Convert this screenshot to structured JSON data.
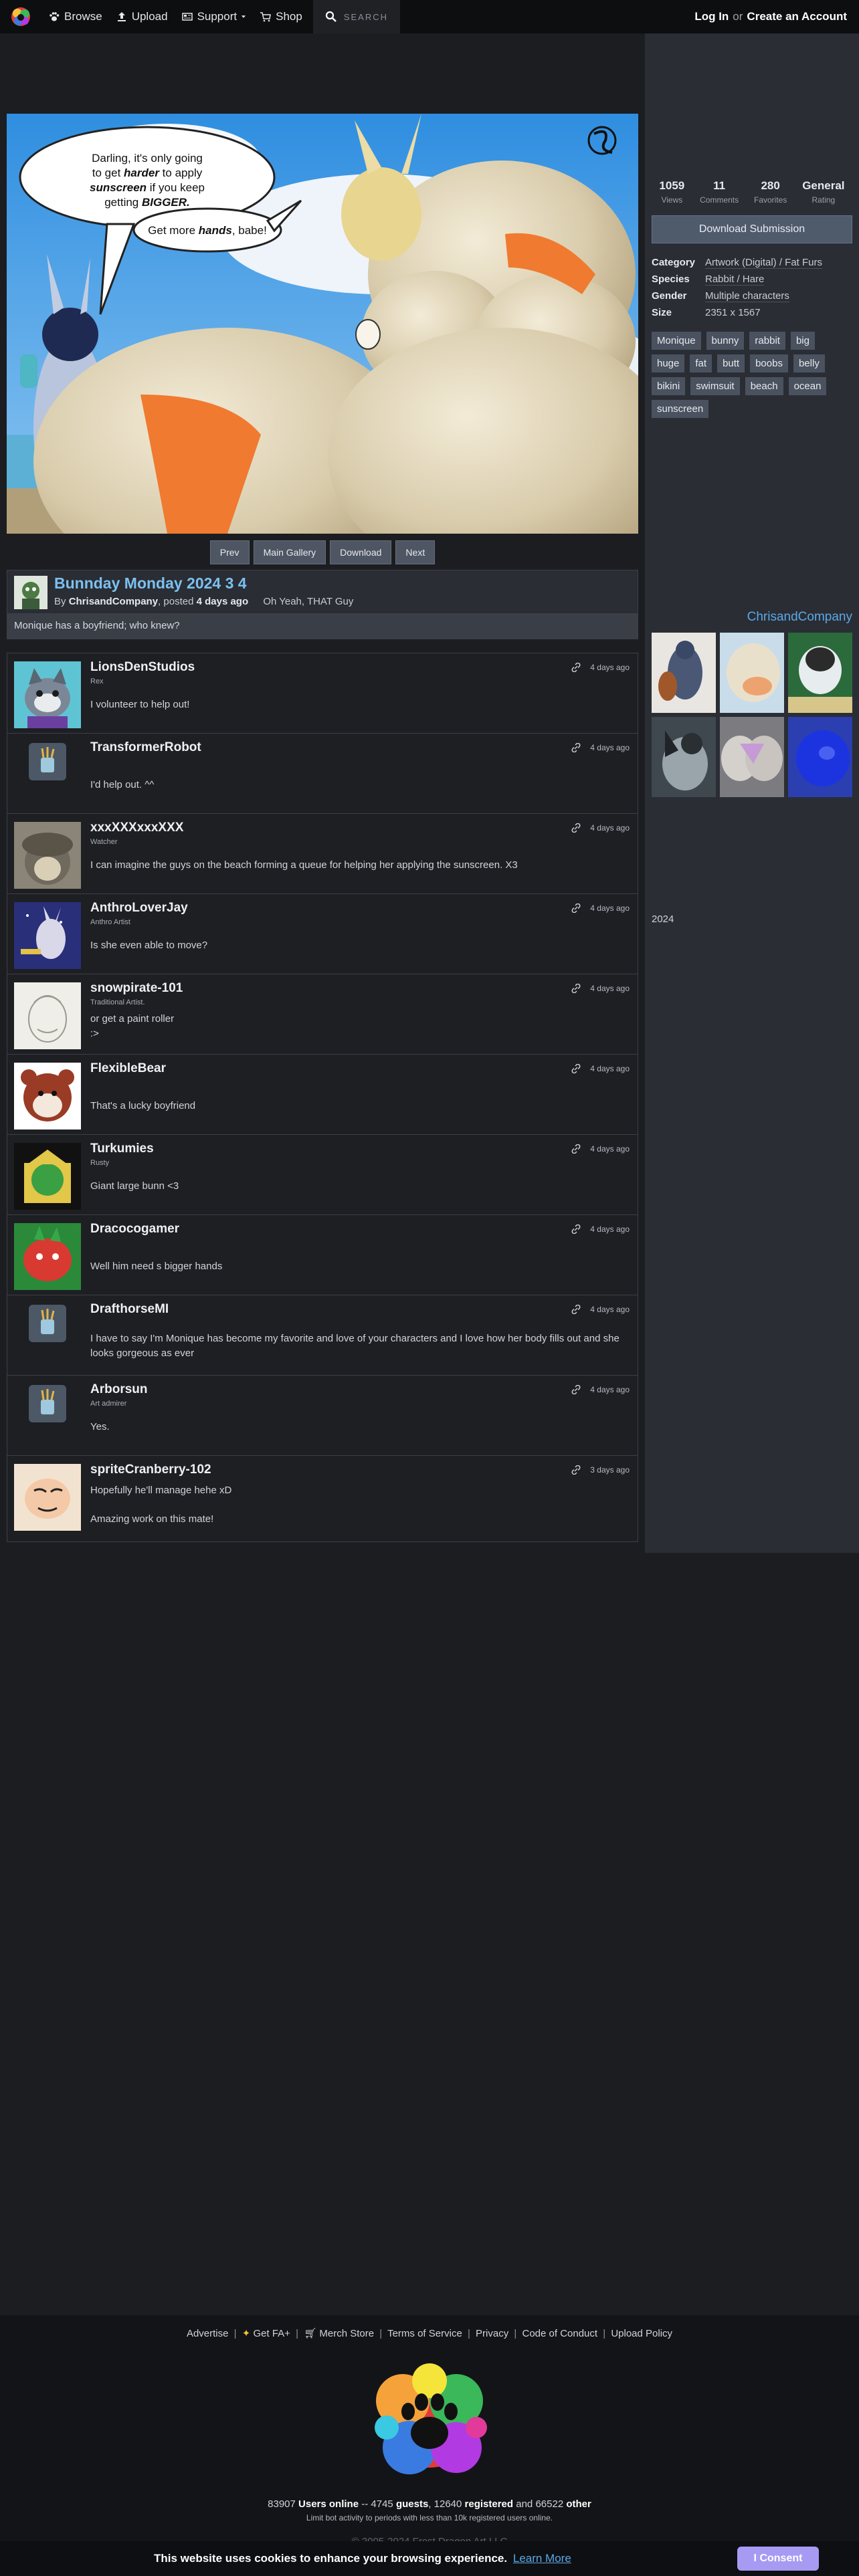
{
  "nav": {
    "browse": "Browse",
    "upload": "Upload",
    "support": "Support",
    "shop": "Shop",
    "search": "SEARCH",
    "login": "Log In",
    "or": "or",
    "create": "Create an Account"
  },
  "image": {
    "bubble1_line1": "Darling, it's only going",
    "bubble1_line2a": "to get ",
    "bubble1_line2b": "harder",
    "bubble1_line2c": " to apply",
    "bubble1_line3a": "sunscreen",
    "bubble1_line3b": " if you keep",
    "bubble1_line4a": "getting ",
    "bubble1_line4b": "BIGGER.",
    "bubble2a": "Get more ",
    "bubble2b": "hands",
    "bubble2c": ", babe!",
    "signature": "Chris and Company"
  },
  "image_nav": {
    "prev": "Prev",
    "gallery": "Main Gallery",
    "download": "Download",
    "next": "Next"
  },
  "submission": {
    "title": "Bunnday Monday 2024 3 4",
    "by": "By",
    "artist": "ChrisandCompany",
    "posted": ", posted",
    "when": "4 days ago",
    "folder": "Oh Yeah, THAT Guy",
    "description": "Monique has a boyfriend; who knew?"
  },
  "stats": [
    {
      "value": "1059",
      "label": "Views"
    },
    {
      "value": "11",
      "label": "Comments"
    },
    {
      "value": "280",
      "label": "Favorites"
    },
    {
      "value": "General",
      "label": "Rating"
    }
  ],
  "sidebar": {
    "download": "Download Submission",
    "info": [
      {
        "key": "Category",
        "value": "Artwork (Digital) / Fat Furs"
      },
      {
        "key": "Species",
        "value": "Rabbit / Hare"
      },
      {
        "key": "Gender",
        "value": "Multiple characters"
      },
      {
        "key": "Size",
        "value": "2351 x 1567"
      }
    ],
    "tags": [
      "Monique",
      "bunny",
      "rabbit",
      "big",
      "huge",
      "fat",
      "butt",
      "boobs",
      "belly",
      "bikini",
      "swimsuit",
      "beach",
      "ocean",
      "sunscreen"
    ],
    "more_from": "ChrisandCompany",
    "year": "2024"
  },
  "comments": [
    {
      "name": "LionsDenStudios",
      "title": "Rex",
      "text": "I volunteer to help out!",
      "time": "4 days ago"
    },
    {
      "name": "TransformerRobot",
      "title": "",
      "text": "I'd help out. ^^",
      "time": "4 days ago"
    },
    {
      "name": "xxxXXXxxxXXX",
      "title": "Watcher",
      "text": "I can imagine the guys on the beach forming a queue for helping her applying the sunscreen. X3",
      "time": "4 days ago"
    },
    {
      "name": "AnthroLoverJay",
      "title": "Anthro Artist",
      "text": "Is she even able to move?",
      "time": "4 days ago"
    },
    {
      "name": "snowpirate-101",
      "title": "Traditional Artist.",
      "text": "or get a paint roller",
      "text2": ":>",
      "time": "4 days ago"
    },
    {
      "name": "FlexibleBear",
      "title": "",
      "text": "That's a lucky boyfriend",
      "time": "4 days ago"
    },
    {
      "name": "Turkumies",
      "title": "Rusty",
      "text": "Giant large bunn <3",
      "time": "4 days ago"
    },
    {
      "name": "Dracocogamer",
      "title": "",
      "text": "Well him need s bigger hands",
      "time": "4 days ago"
    },
    {
      "name": "DrafthorseMI",
      "title": "",
      "text": "I have to say I'm Monique has become my favorite and love of your characters and I love how her body fills out and she looks gorgeous as ever",
      "time": "4 days ago"
    },
    {
      "name": "Arborsun",
      "title": "Art admirer",
      "text": "Yes.",
      "time": "4 days ago"
    },
    {
      "name": "spriteCranberry-102",
      "title": "",
      "text": "Hopefully he'll manage hehe xD",
      "text2": "Amazing work on this mate!",
      "time": "3 days ago"
    }
  ],
  "footer": {
    "advertise": "Advertise",
    "getfa": "Get FA+",
    "merch": "Merch Store",
    "tos": "Terms of Service",
    "privacy": "Privacy",
    "conduct": "Code of Conduct",
    "upload_policy": "Upload Policy",
    "users_online_num": "83907",
    "users_online": "Users online",
    "guests_num": "4745",
    "guests": "guests",
    "registered_num": "12640",
    "registered": "registered",
    "and": "and",
    "other_num": "66522",
    "other": "other",
    "limit": "Limit bot activity to periods with less than 10k registered users online.",
    "copyright": "© 2005-2024 Frost Dragon Art LLC"
  },
  "cookie": {
    "text": "This website uses cookies to enhance your browsing experience.",
    "learn": "Learn More",
    "consent": "I Consent"
  },
  "colors": {
    "link": "#5aa9e8",
    "title": "#7cc0f0",
    "consent": "#a79af3",
    "bikini": "#f07a30"
  }
}
